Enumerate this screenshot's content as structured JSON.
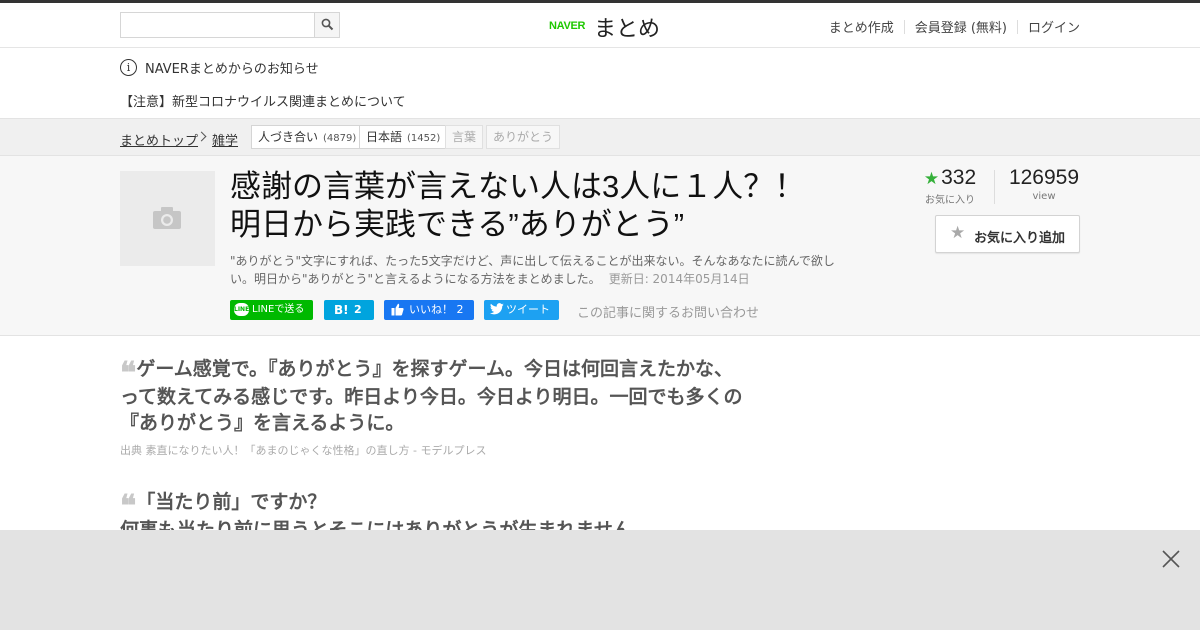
{
  "header": {
    "search_placeholder": "",
    "logo_naver": "NAVER",
    "logo_matome": "まとめ",
    "nav": [
      "まとめ作成",
      "会員登録 (無料)",
      "ログイン"
    ]
  },
  "notice": {
    "text": "NAVERまとめからのお知らせ",
    "warning": "【注意】新型コロナウイルス関連まとめについて"
  },
  "breadcrumb": {
    "items": [
      "まとめトップ",
      "雑学"
    ],
    "tags": [
      {
        "label": "人づき合い",
        "count": "(4879)"
      },
      {
        "label": "日本語",
        "count": "(1452)"
      },
      {
        "label": "言葉",
        "count": ""
      },
      {
        "label": "ありがとう",
        "count": ""
      }
    ]
  },
  "article": {
    "title_line1": "感謝の言葉が言えない人は3人に１人？！",
    "title_line2": "明日から実践できる”ありがとう”",
    "description": "\"ありがとう\"文字にすれば、たった5文字だけど、声に出して伝えることが出来ない。そんなあなたに読んで欲しい。明日から\"ありがとう\"と言えるようになる方法をまとめました。",
    "updated": "更新日: 2014年05月14日",
    "favorites": "332",
    "favorites_label": "お気に入り",
    "views": "126959",
    "views_label": "view",
    "fav_button": "お気に入り追加",
    "share": {
      "line": "LINEで送る",
      "line_logo": "LINE",
      "hatena_b": "B!",
      "hatena_count": "2",
      "fb": "いいね！ 2",
      "tweet": "ツイート"
    },
    "inquiry": "この記事に関するお問い合わせ"
  },
  "quotes": [
    {
      "mark": "❛❛",
      "text": "ゲーム感覚で。『ありがとう』を探すゲーム。今日は何回言えたかな、って数えてみる感じです。昨日より今日。今日より明日。一回でも多くの『ありがとう』を言えるように。",
      "source": "出典 素直になりたい人！「あまのじゃくな性格」の直し方 - モデルプレス"
    },
    {
      "mark": "❛❛",
      "text": "「当たり前」ですか？\n何事も当たり前に思うとそこにはありがとうが生まれません",
      "source": ""
    }
  ],
  "colors": {
    "line_green": "#00b900",
    "hatena_blue": "#00a4de",
    "fb_blue": "#1877f2",
    "twitter_blue": "#1da1f2",
    "star_green": "#34b03a",
    "naver_green": "#1ec800"
  },
  "icons": [
    "search-icon",
    "info-icon",
    "camera-icon",
    "star-icon",
    "thumbs-up-icon",
    "bird-icon",
    "close-icon"
  ]
}
